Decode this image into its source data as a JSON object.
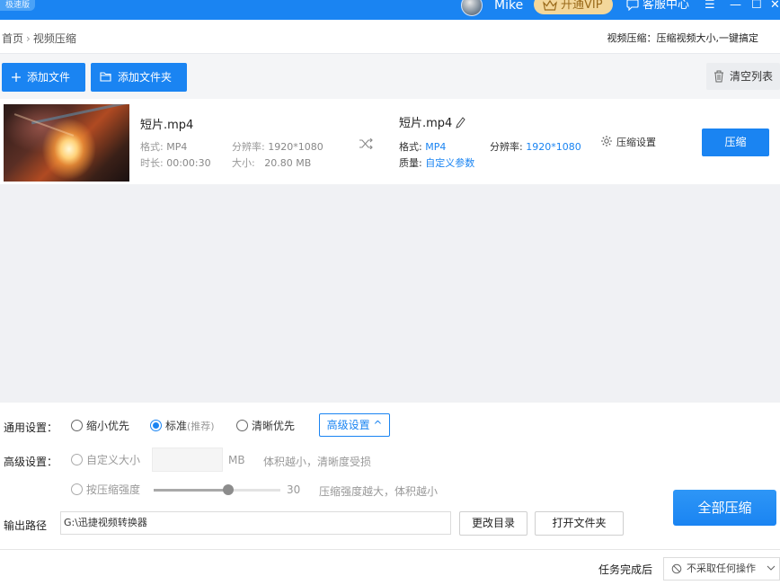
{
  "titlebar": {
    "edition_badge": "极速版",
    "user_name": "Mike",
    "vip_label": "开通VIP",
    "service_label": "客服中心",
    "menu_glyph": "☰",
    "minimize_glyph": "—",
    "maximize_glyph": "☐",
    "close_glyph": "✕"
  },
  "breadcrumb": {
    "home": "首页",
    "separator": "›",
    "current": "视频压缩",
    "tagline": "视频压缩：压缩视频大小,一键搞定"
  },
  "toolbar": {
    "add_file": "添加文件",
    "add_folder": "添加文件夹",
    "clear_list": "清空列表"
  },
  "files": [
    {
      "source": {
        "name": "短片.mp4",
        "format_label": "格式:",
        "format": "MP4",
        "duration_label": "时长:",
        "duration": "00:00:30",
        "resolution_label": "分辨率:",
        "resolution": "1920*1080",
        "size_label": "大小:",
        "size": "20.80 MB"
      },
      "output": {
        "name": "短片.mp4",
        "format_label": "格式:",
        "format": "MP4",
        "resolution_label": "分辨率:",
        "resolution": "1920*1080",
        "quality_label": "质量:",
        "quality": "自定义参数"
      },
      "settings_link": "压缩设置",
      "compress_button": "压缩"
    }
  ],
  "settings": {
    "general_label": "通用设置：",
    "options": [
      {
        "label": "缩小优先",
        "hint": "",
        "selected": false
      },
      {
        "label": "标准",
        "hint": "(推荐)",
        "selected": true
      },
      {
        "label": "清晰优先",
        "hint": "",
        "selected": false
      }
    ],
    "advanced_button": "高级设置 ^",
    "advanced_label": "高级设置：",
    "custom_size_label": "自定义大小",
    "custom_size_value": "",
    "size_unit": "MB",
    "size_hint": "体积越小，清晰度受损",
    "strength_label": "按压缩强度",
    "strength_value": "30",
    "strength_fraction": 0.59,
    "strength_hint": "压缩强度越大，体积越小",
    "output_path_label": "输出路径",
    "output_path": "G:\\迅捷视频转换器",
    "change_dir": "更改目录",
    "open_folder": "打开文件夹",
    "compress_all": "全部压缩",
    "after_task_label": "任务完成后",
    "after_task_value": "不采取任何操作"
  },
  "colors": {
    "accent": "#1a84f2",
    "vip_bg": "#f3d79b"
  }
}
